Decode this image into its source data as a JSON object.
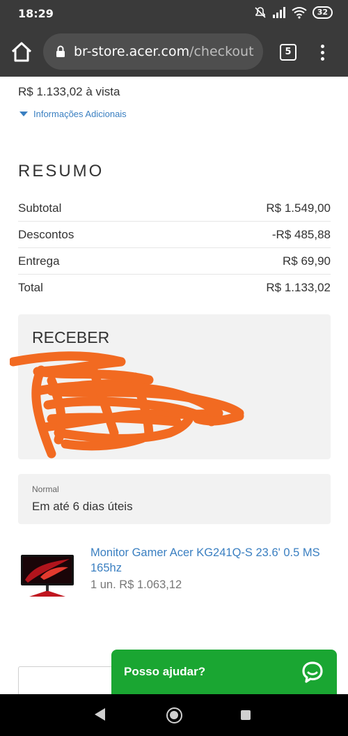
{
  "status_bar": {
    "time": "18:29",
    "battery": "32",
    "icons": [
      "mute-icon",
      "signal-icon",
      "wifi-icon",
      "battery-icon"
    ]
  },
  "browser": {
    "url_host": "br-store.acer.com",
    "url_path": "/checkout",
    "tab_count": "5"
  },
  "page": {
    "price_line": "R$ 1.133,02 à vista",
    "info_link": "Informações Adicionais",
    "summary": {
      "title": "RESUMO",
      "rows": [
        {
          "label": "Subtotal",
          "value": "R$ 1.549,00"
        },
        {
          "label": "Descontos",
          "value": "-R$ 485,88"
        },
        {
          "label": "Entrega",
          "value": "R$ 69,90"
        },
        {
          "label": "Total",
          "value": "R$ 1.133,02"
        }
      ]
    },
    "receive": {
      "title": "RECEBER",
      "redaction_color": "#f26a21"
    },
    "shipping": {
      "label": "Normal",
      "value": "Em até 6 dias úteis"
    },
    "product": {
      "name": "Monitor Gamer Acer KG241Q-S 23.6' 0.5 MS 165hz",
      "qty_price": "1 un. R$ 1.063,12"
    },
    "help_button": {
      "label": "Posso ajudar?",
      "color": "#1aa632"
    }
  }
}
